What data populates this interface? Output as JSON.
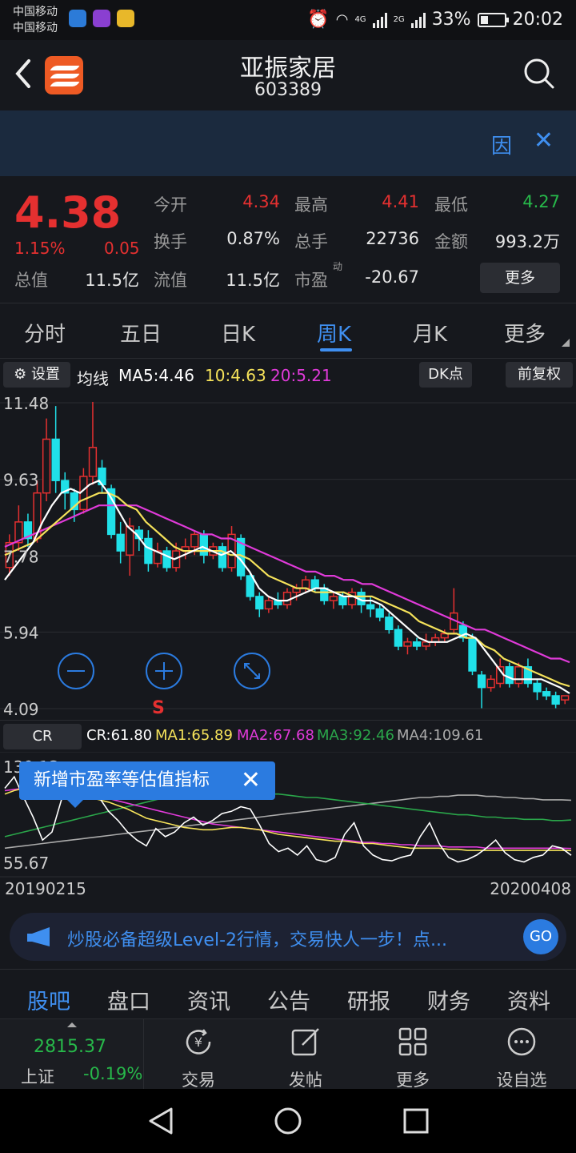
{
  "status_bar": {
    "carrier1": "中国移动",
    "carrier2": "中国移动",
    "net_4g": "4G",
    "net_2g": "2G",
    "battery_pct": "33%",
    "battery_level": 0.33,
    "time": "20:02"
  },
  "header": {
    "title": "亚振家居",
    "code": "603389"
  },
  "banner": {
    "yin_label": "因"
  },
  "quote": {
    "price": "4.38",
    "change_pct": "1.15%",
    "change": "0.05",
    "fields": {
      "open_label": "今开",
      "open": "4.34",
      "high_label": "最高",
      "high": "4.41",
      "low_label": "最低",
      "low": "4.27",
      "turnover_label": "换手",
      "turnover": "0.87%",
      "volume_label": "总手",
      "volume": "22736",
      "amount_label": "金额",
      "amount": "993.2万",
      "mktcap_label": "总值",
      "mktcap": "11.5亿",
      "float_label": "流值",
      "float": "11.5亿",
      "pe_label": "市盈",
      "pe_sup": "动",
      "pe": "-20.67"
    },
    "more_label": "更多"
  },
  "period_tabs": [
    "分时",
    "五日",
    "日K",
    "周K",
    "月K",
    "更多"
  ],
  "active_tab": 3,
  "ma_bar": {
    "settings_label": "设置",
    "ma_label": "均线",
    "ma5": "MA5:4.46",
    "ma10": "10:4.63",
    "ma20": "20:5.21",
    "dk_label": "DK点",
    "adjust_label": "前复权"
  },
  "chart_data": [
    {
      "type": "candlestick",
      "y_ticks": [
        "11.48",
        "9.63",
        "7.78",
        "5.94",
        "4.09"
      ],
      "ylim": [
        4.09,
        11.48
      ],
      "marker_label": "S",
      "candles": [
        {
          "o": 7.5,
          "c": 8.1,
          "h": 8.3,
          "l": 7.3
        },
        {
          "o": 8.1,
          "c": 8.6,
          "h": 9.0,
          "l": 7.9
        },
        {
          "o": 8.6,
          "c": 8.2,
          "h": 8.8,
          "l": 8.0
        },
        {
          "o": 8.2,
          "c": 9.3,
          "h": 9.6,
          "l": 8.1
        },
        {
          "o": 9.3,
          "c": 10.6,
          "h": 11.1,
          "l": 9.1
        },
        {
          "o": 10.6,
          "c": 9.6,
          "h": 11.4,
          "l": 9.3
        },
        {
          "o": 9.6,
          "c": 9.3,
          "h": 9.8,
          "l": 8.9
        },
        {
          "o": 9.3,
          "c": 8.9,
          "h": 9.4,
          "l": 8.6
        },
        {
          "o": 8.9,
          "c": 9.7,
          "h": 9.9,
          "l": 8.8
        },
        {
          "o": 9.7,
          "c": 10.4,
          "h": 11.5,
          "l": 9.5
        },
        {
          "o": 9.9,
          "c": 9.5,
          "h": 10.1,
          "l": 9.3
        },
        {
          "o": 9.4,
          "c": 8.3,
          "h": 9.5,
          "l": 8.2
        },
        {
          "o": 8.3,
          "c": 7.9,
          "h": 8.6,
          "l": 7.6
        },
        {
          "o": 7.8,
          "c": 8.5,
          "h": 8.7,
          "l": 7.3
        },
        {
          "o": 8.4,
          "c": 8.2,
          "h": 8.5,
          "l": 7.9
        },
        {
          "o": 8.2,
          "c": 7.6,
          "h": 8.4,
          "l": 7.4
        },
        {
          "o": 7.6,
          "c": 7.9,
          "h": 8.1,
          "l": 7.5
        },
        {
          "o": 7.9,
          "c": 7.5,
          "h": 8.0,
          "l": 7.4
        },
        {
          "o": 7.5,
          "c": 7.9,
          "h": 8.1,
          "l": 7.4
        },
        {
          "o": 7.9,
          "c": 8.0,
          "h": 8.2,
          "l": 7.7
        },
        {
          "o": 8.0,
          "c": 8.3,
          "h": 8.4,
          "l": 7.8
        },
        {
          "o": 8.3,
          "c": 7.8,
          "h": 8.4,
          "l": 7.6
        },
        {
          "o": 7.8,
          "c": 8.0,
          "h": 8.1,
          "l": 7.7
        },
        {
          "o": 8.0,
          "c": 7.5,
          "h": 8.1,
          "l": 7.4
        },
        {
          "o": 7.5,
          "c": 8.3,
          "h": 8.5,
          "l": 7.4
        },
        {
          "o": 8.2,
          "c": 7.3,
          "h": 8.3,
          "l": 7.2
        },
        {
          "o": 7.3,
          "c": 6.8,
          "h": 7.4,
          "l": 6.7
        },
        {
          "o": 6.8,
          "c": 6.5,
          "h": 6.9,
          "l": 6.3
        },
        {
          "o": 6.5,
          "c": 6.7,
          "h": 6.8,
          "l": 6.4
        },
        {
          "o": 6.7,
          "c": 6.6,
          "h": 6.9,
          "l": 6.5
        },
        {
          "o": 6.6,
          "c": 6.9,
          "h": 7.0,
          "l": 6.5
        },
        {
          "o": 6.9,
          "c": 7.0,
          "h": 7.1,
          "l": 6.7
        },
        {
          "o": 7.0,
          "c": 7.2,
          "h": 7.3,
          "l": 6.9
        },
        {
          "o": 7.2,
          "c": 7.0,
          "h": 7.3,
          "l": 6.9
        },
        {
          "o": 7.0,
          "c": 6.7,
          "h": 7.1,
          "l": 6.6
        },
        {
          "o": 6.7,
          "c": 6.8,
          "h": 6.9,
          "l": 6.5
        },
        {
          "o": 6.8,
          "c": 6.6,
          "h": 6.9,
          "l": 6.5
        },
        {
          "o": 6.6,
          "c": 6.9,
          "h": 7.0,
          "l": 6.5
        },
        {
          "o": 6.9,
          "c": 6.6,
          "h": 7.0,
          "l": 6.4
        },
        {
          "o": 6.6,
          "c": 6.5,
          "h": 6.8,
          "l": 6.3
        },
        {
          "o": 6.5,
          "c": 6.3,
          "h": 6.6,
          "l": 6.2
        },
        {
          "o": 6.3,
          "c": 6.0,
          "h": 6.4,
          "l": 5.9
        },
        {
          "o": 6.0,
          "c": 5.6,
          "h": 6.1,
          "l": 5.5
        },
        {
          "o": 5.6,
          "c": 5.7,
          "h": 5.8,
          "l": 5.4
        },
        {
          "o": 5.7,
          "c": 5.6,
          "h": 5.8,
          "l": 5.5
        },
        {
          "o": 5.6,
          "c": 5.7,
          "h": 5.9,
          "l": 5.5
        },
        {
          "o": 5.7,
          "c": 5.8,
          "h": 5.9,
          "l": 5.6
        },
        {
          "o": 5.8,
          "c": 5.9,
          "h": 6.0,
          "l": 5.7
        },
        {
          "o": 6.0,
          "c": 6.4,
          "h": 7.0,
          "l": 5.9
        },
        {
          "o": 6.1,
          "c": 5.8,
          "h": 6.2,
          "l": 5.7
        },
        {
          "o": 5.8,
          "c": 5.0,
          "h": 5.9,
          "l": 4.9
        },
        {
          "o": 4.9,
          "c": 4.6,
          "h": 5.0,
          "l": 4.1
        },
        {
          "o": 4.6,
          "c": 4.8,
          "h": 4.9,
          "l": 4.5
        },
        {
          "o": 4.7,
          "c": 5.1,
          "h": 5.3,
          "l": 4.6
        },
        {
          "o": 5.1,
          "c": 4.7,
          "h": 5.2,
          "l": 4.6
        },
        {
          "o": 4.7,
          "c": 5.1,
          "h": 5.2,
          "l": 4.6
        },
        {
          "o": 5.1,
          "c": 4.7,
          "h": 5.3,
          "l": 4.6
        },
        {
          "o": 4.7,
          "c": 4.5,
          "h": 4.8,
          "l": 4.3
        },
        {
          "o": 4.5,
          "c": 4.4,
          "h": 4.6,
          "l": 4.3
        },
        {
          "o": 4.4,
          "c": 4.2,
          "h": 4.5,
          "l": 4.1
        },
        {
          "o": 4.3,
          "c": 4.4,
          "h": 4.4,
          "l": 4.2
        }
      ],
      "ma5": [
        7.2,
        7.5,
        7.8,
        8.1,
        8.6,
        9.0,
        9.3,
        9.4,
        9.3,
        9.5,
        9.6,
        9.3,
        8.9,
        8.5,
        8.3,
        8.0,
        7.9,
        7.8,
        7.7,
        7.8,
        7.9,
        8.0,
        7.9,
        7.8,
        7.9,
        7.7,
        7.4,
        7.0,
        6.8,
        6.7,
        6.7,
        6.8,
        6.9,
        7.0,
        7.0,
        6.9,
        6.8,
        6.8,
        6.7,
        6.7,
        6.6,
        6.4,
        6.2,
        6.0,
        5.8,
        5.7,
        5.7,
        5.7,
        5.8,
        5.9,
        5.8,
        5.5,
        5.2,
        4.9,
        4.8,
        4.8,
        4.8,
        4.8,
        4.7,
        4.6,
        4.46
      ],
      "ma10": [
        7.8,
        7.9,
        8.0,
        8.1,
        8.3,
        8.5,
        8.7,
        8.9,
        9.1,
        9.2,
        9.3,
        9.3,
        9.2,
        9.0,
        8.9,
        8.6,
        8.4,
        8.2,
        8.0,
        7.9,
        7.9,
        7.9,
        7.9,
        7.9,
        7.8,
        7.8,
        7.7,
        7.5,
        7.3,
        7.2,
        7.1,
        7.0,
        7.0,
        6.9,
        6.9,
        6.9,
        6.9,
        6.8,
        6.8,
        6.8,
        6.7,
        6.6,
        6.5,
        6.4,
        6.2,
        6.1,
        6.0,
        5.9,
        5.9,
        5.8,
        5.8,
        5.6,
        5.5,
        5.3,
        5.2,
        5.1,
        5.0,
        4.9,
        4.8,
        4.7,
        4.63
      ],
      "ma20": [
        8.0,
        8.1,
        8.2,
        8.3,
        8.4,
        8.5,
        8.6,
        8.7,
        8.8,
        8.9,
        9.0,
        9.0,
        9.0,
        9.0,
        9.0,
        8.9,
        8.8,
        8.7,
        8.6,
        8.5,
        8.4,
        8.3,
        8.3,
        8.2,
        8.2,
        8.1,
        8.0,
        7.9,
        7.8,
        7.7,
        7.6,
        7.5,
        7.4,
        7.4,
        7.3,
        7.3,
        7.2,
        7.2,
        7.1,
        7.1,
        7.0,
        6.9,
        6.8,
        6.7,
        6.6,
        6.5,
        6.4,
        6.3,
        6.2,
        6.1,
        6.0,
        6.0,
        5.9,
        5.8,
        5.7,
        5.6,
        5.5,
        5.4,
        5.3,
        5.3,
        5.21
      ]
    },
    {
      "type": "line",
      "indicator": "CR",
      "y_ticks": [
        "139.13",
        "55.67"
      ],
      "ylim": [
        55.67,
        139.13
      ],
      "x_start": "20190215",
      "x_end": "20200408",
      "series": [
        {
          "name": "CR:61.80",
          "color": "#ffffff",
          "values": [
            120,
            130,
            112,
            95,
            75,
            82,
            110,
            138,
            128,
            118,
            112,
            100,
            92,
            82,
            75,
            70,
            85,
            78,
            82,
            90,
            95,
            88,
            92,
            98,
            100,
            104,
            102,
            88,
            72,
            65,
            68,
            62,
            70,
            58,
            56,
            60,
            80,
            90,
            70,
            62,
            58,
            57,
            60,
            62,
            78,
            90,
            72,
            60,
            56,
            58,
            62,
            68,
            75,
            64,
            58,
            56,
            60,
            62,
            70,
            68,
            61.8
          ]
        },
        {
          "name": "MA1:65.89",
          "color": "#f5e25a",
          "values": [
            115,
            118,
            120,
            121,
            120,
            118,
            116,
            115,
            114,
            112,
            110,
            108,
            105,
            102,
            98,
            94,
            92,
            90,
            88,
            86,
            85,
            84,
            84,
            85,
            86,
            86,
            85,
            84,
            82,
            80,
            79,
            78,
            77,
            76,
            75,
            74,
            74,
            73,
            72,
            72,
            71,
            70,
            69,
            68,
            68,
            68,
            68,
            67,
            67,
            66,
            66,
            66,
            66,
            66,
            66,
            66,
            66,
            66,
            66,
            66,
            65.89
          ]
        },
        {
          "name": "MA2:67.68",
          "color": "#e03ad9",
          "values": [
            118,
            119,
            120,
            120,
            119,
            118,
            117,
            116,
            115,
            114,
            113,
            111,
            109,
            107,
            105,
            103,
            101,
            99,
            97,
            95,
            93,
            91,
            89,
            88,
            87,
            86,
            85,
            84,
            83,
            82,
            81,
            80,
            79,
            78,
            77,
            76,
            75,
            74,
            73,
            73,
            72,
            72,
            71,
            71,
            70,
            70,
            70,
            69,
            69,
            69,
            69,
            68,
            68,
            68,
            68,
            68,
            68,
            68,
            68,
            68,
            67.68
          ]
        },
        {
          "name": "MA3:92.46",
          "color": "#2aa64a",
          "values": [
            78,
            80,
            82,
            84,
            86,
            88,
            90,
            92,
            94,
            96,
            98,
            100,
            102,
            104,
            106,
            108,
            110,
            112,
            113,
            114,
            115,
            116,
            117,
            117,
            117,
            117,
            116,
            116,
            115,
            115,
            114,
            113,
            112,
            112,
            111,
            110,
            109,
            108,
            107,
            106,
            105,
            104,
            103,
            102,
            101,
            100,
            99,
            98,
            97,
            97,
            96,
            95,
            95,
            94,
            94,
            93,
            93,
            93,
            92,
            92,
            92.46
          ]
        },
        {
          "name": "MA4:109.61",
          "color": "#aaaaaa",
          "values": [
            68,
            69,
            70,
            71,
            72,
            73,
            74,
            75,
            76,
            77,
            78,
            79,
            80,
            81,
            82,
            83,
            84,
            85,
            86,
            87,
            88,
            89,
            90,
            91,
            92,
            93,
            94,
            95,
            96,
            97,
            98,
            99,
            100,
            101,
            102,
            103,
            104,
            105,
            106,
            107,
            108,
            109,
            110,
            111,
            112,
            112,
            113,
            113,
            114,
            114,
            114,
            113,
            113,
            112,
            112,
            111,
            111,
            110,
            110,
            110,
            109.61
          ]
        }
      ]
    }
  ],
  "cr_bar": {
    "tab_label": "CR",
    "cr": "CR:61.80",
    "ma1": "MA1:65.89",
    "ma2": "MA2:67.68",
    "ma3": "MA3:92.46",
    "ma4": "MA4:109.61"
  },
  "tooltip": "新增市盈率等估值指标",
  "promo": {
    "text": "炒股必备超级Level-2行情，交易快人一步！点...",
    "go": "GO"
  },
  "bottom_tabs": [
    "股吧",
    "盘口",
    "资讯",
    "公告",
    "研报",
    "财务",
    "资料"
  ],
  "active_bottom_tab": 0,
  "index": {
    "value": "2815.37",
    "name": "上证",
    "pct": "-0.19%"
  },
  "bottom_nav": [
    "交易",
    "发帖",
    "更多",
    "设自选"
  ],
  "colors": {
    "up": "#e53030",
    "down": "#27b84a",
    "candle_down": "#20e0e8",
    "accent": "#3f8ff0",
    "ma5": "#ffffff",
    "ma10": "#f5e25a",
    "ma20": "#e03ad9"
  }
}
